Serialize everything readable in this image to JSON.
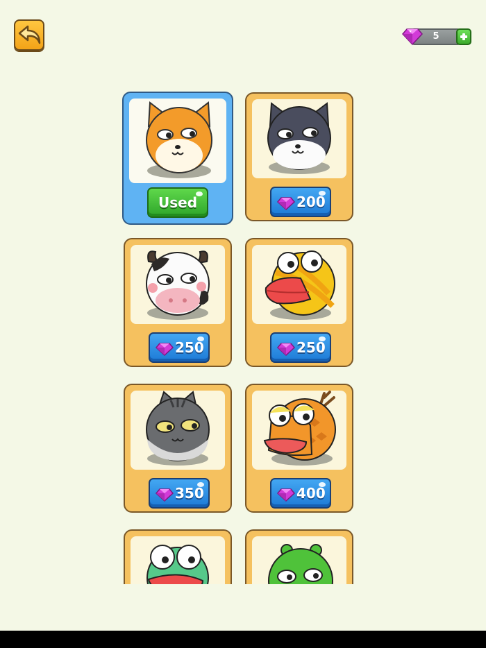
{
  "header": {
    "back_icon": "back-arrow-icon",
    "gems": {
      "icon": "gem-icon",
      "count": "5",
      "add_icon": "plus-icon"
    }
  },
  "skins": [
    {
      "character": "shiba-dog",
      "price_label": "Used",
      "state": "used"
    },
    {
      "character": "husky",
      "price_label": "200",
      "state": "buy"
    },
    {
      "character": "cow",
      "price_label": "250",
      "state": "buy"
    },
    {
      "character": "duck",
      "price_label": "250",
      "state": "buy"
    },
    {
      "character": "gray-cat",
      "price_label": "350",
      "state": "buy"
    },
    {
      "character": "dragon",
      "price_label": "400",
      "state": "buy"
    },
    {
      "character": "frog",
      "price_label": "",
      "state": "buy"
    },
    {
      "character": "green-monster",
      "price_label": "",
      "state": "buy"
    }
  ],
  "colors": {
    "background": "#f4f8e6",
    "card": "#f5c15f",
    "selected_card": "#5fb3f3",
    "price_button": "#2b8fe6",
    "used_button": "#3fbe35"
  }
}
